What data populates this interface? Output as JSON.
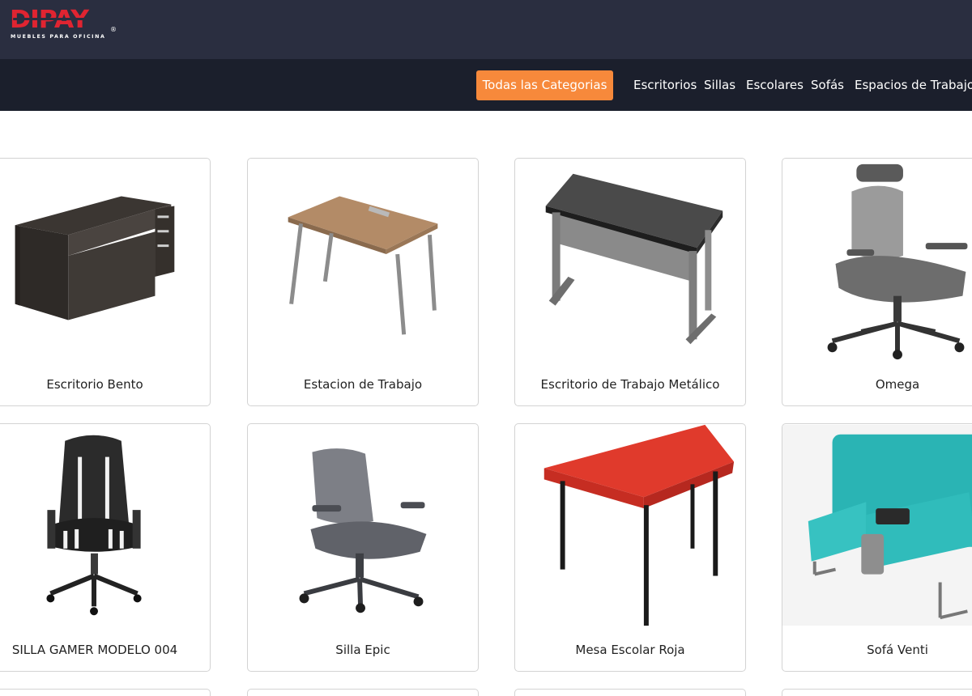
{
  "header": {
    "logo_text": "DIPAY",
    "logo_registered": "®",
    "logo_tagline": "MUEBLES PARA OFICINA"
  },
  "nav": {
    "all_categories": "Todas las Categorias",
    "links": [
      "Escritorios",
      "Sillas",
      "Escolares",
      "Sofás",
      "Espacios de Trabajo"
    ]
  },
  "colors": {
    "topbar": "#2a2e40",
    "navbar": "#1b1f2c",
    "accent": "#f7893b",
    "logo_red": "#e02431"
  },
  "products": [
    {
      "name": "Escritorio Bento",
      "image": "dark-wood-desk"
    },
    {
      "name": "Estacion de Trabajo",
      "image": "wood-top-desk"
    },
    {
      "name": "Escritorio de Trabajo Metálico",
      "image": "metal-desk"
    },
    {
      "name": "Omega",
      "image": "mesh-office-chair"
    },
    {
      "name": "SILLA GAMER MODELO 004",
      "image": "gamer-chair"
    },
    {
      "name": "Silla Epic",
      "image": "gray-mesh-chair"
    },
    {
      "name": "Mesa Escolar Roja",
      "image": "red-school-table"
    },
    {
      "name": "Sofá Venti",
      "image": "teal-sofa"
    }
  ]
}
